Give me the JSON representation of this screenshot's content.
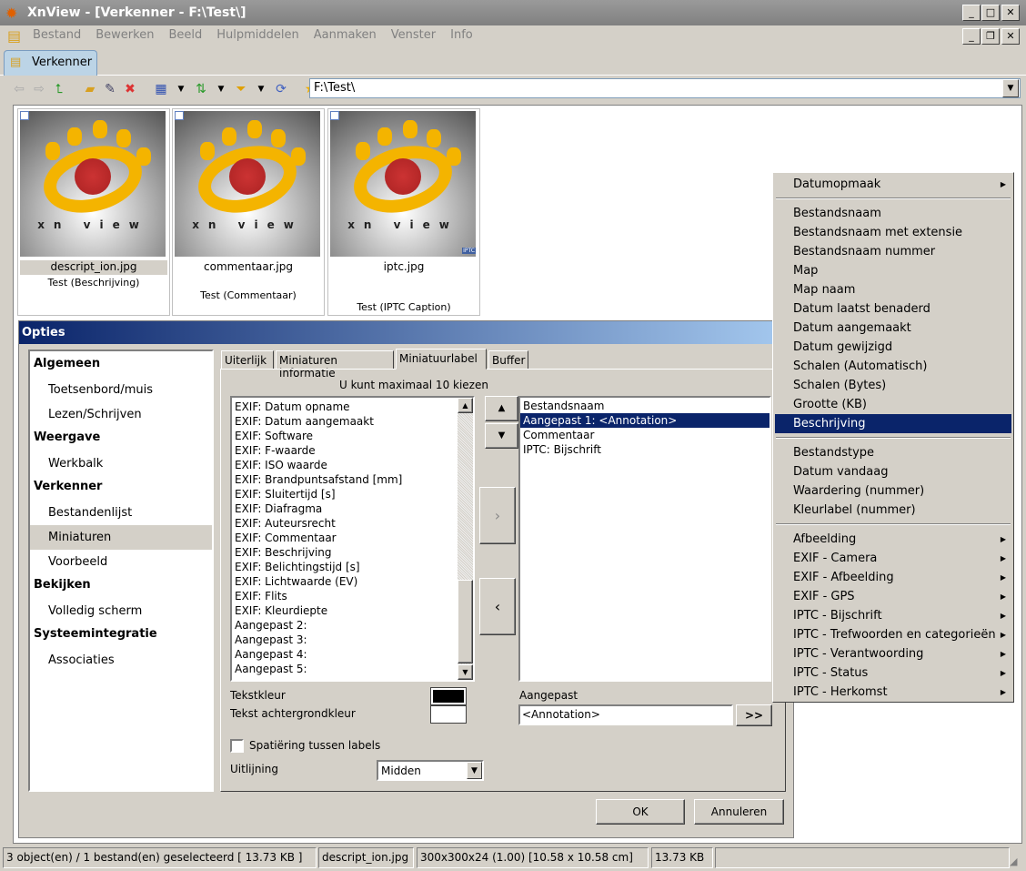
{
  "window": {
    "title": "XnView - [Verkenner - F:\\Test\\]",
    "minimize": "_",
    "maximize": "□",
    "close": "✕",
    "restore": "❐"
  },
  "menu": [
    "Bestand",
    "Bewerken",
    "Beeld",
    "Hulpmiddelen",
    "Aanmaken",
    "Venster",
    "Info"
  ],
  "tab": "Verkenner",
  "toolbar": {
    "address": "F:\\Test\\"
  },
  "thumbnails": [
    {
      "file": "descript_ion.jpg",
      "label": "Test (Beschrijving)",
      "logo": "xnview"
    },
    {
      "file": "commentaar.jpg",
      "label": "Test (Commentaar)",
      "logo": "xnview"
    },
    {
      "file": "iptc.jpg",
      "label": "Test (IPTC Caption)",
      "logo": "xnview",
      "badge": "IPTC"
    }
  ],
  "dialog": {
    "title": "Opties",
    "nav": {
      "Algemeen": "Algemeen",
      "items": [
        "Toetsenbord/muis",
        "Lezen/Schrijven"
      ],
      "Weergave": "Weergave",
      "weergave_items": [
        "Werkbalk"
      ],
      "Verkenner": "Verkenner",
      "verkenner_items": [
        "Bestandenlijst",
        "Miniaturen",
        "Voorbeeld"
      ],
      "Bekijken": "Bekijken",
      "bekijken_items": [
        "Volledig scherm"
      ],
      "Systeem": "Systeemintegratie",
      "systeem_items": [
        "Associaties"
      ]
    },
    "tabs": [
      "Uiterlijk",
      "Miniaturen informatie",
      "Miniatuurlabel",
      "Buffer"
    ],
    "hint": "U kunt maximaal 10 kiezen",
    "available": [
      "EXIF: Datum opname",
      "EXIF: Datum aangemaakt",
      "EXIF: Software",
      "EXIF: F-waarde",
      "EXIF: ISO waarde",
      "EXIF: Brandpuntsafstand [mm]",
      "EXIF: Sluitertijd [s]",
      "EXIF: Diafragma",
      "EXIF: Auteursrecht",
      "EXIF: Commentaar",
      "EXIF: Beschrijving",
      "EXIF: Belichtingstijd [s]",
      "EXIF: Lichtwaarde (EV)",
      "EXIF: Flits",
      "EXIF: Kleurdiepte",
      "Aangepast 2:",
      "Aangepast 3:",
      "Aangepast 4:",
      "Aangepast 5:"
    ],
    "selected": [
      "Bestandsnaam",
      "Aangepast 1: <Annotation>",
      "Commentaar",
      "IPTC: Bijschrift"
    ],
    "up": "▲",
    "down": "▼",
    "add": "›",
    "remove": "‹",
    "text_color_label": "Tekstkleur",
    "bg_color_label": "Tekst achtergrondkleur",
    "text_color": "#000000",
    "bg_color": "#ffffff",
    "custom_label": "Aangepast",
    "custom_value": "<Annotation>",
    "custom_btn": ">>",
    "spacing_label": "Spatiëring tussen labels",
    "align_label": "Uitlijning",
    "align_value": "Midden",
    "ok": "OK",
    "cancel": "Annuleren"
  },
  "context_menu": {
    "groups": [
      [
        "Datumopmaak"
      ],
      [
        "Bestandsnaam",
        "Bestandsnaam met extensie",
        "Bestandsnaam nummer",
        "Map",
        "Map naam",
        "Datum laatst benaderd",
        "Datum aangemaakt",
        "Datum gewijzigd",
        "Schalen (Automatisch)",
        "Schalen (Bytes)",
        "Grootte (KB)",
        "Beschrijving"
      ],
      [
        "Bestandstype",
        "Datum vandaag",
        "Waardering (nummer)",
        "Kleurlabel (nummer)"
      ],
      [
        "Afbeelding",
        "EXIF - Camera",
        "EXIF - Afbeelding",
        "EXIF - GPS",
        "IPTC - Bijschrift",
        "IPTC - Trefwoorden en categorieën",
        "IPTC - Verantwoording",
        "IPTC - Status",
        "IPTC - Herkomst"
      ]
    ],
    "highlighted": "Beschrijving"
  },
  "status": [
    "3 object(en) / 1 bestand(en) geselecteerd  [ 13.73 KB ]",
    "descript_ion.jpg",
    "300x300x24 (1.00) [10.58 x 10.58 cm]",
    "13.73 KB"
  ]
}
